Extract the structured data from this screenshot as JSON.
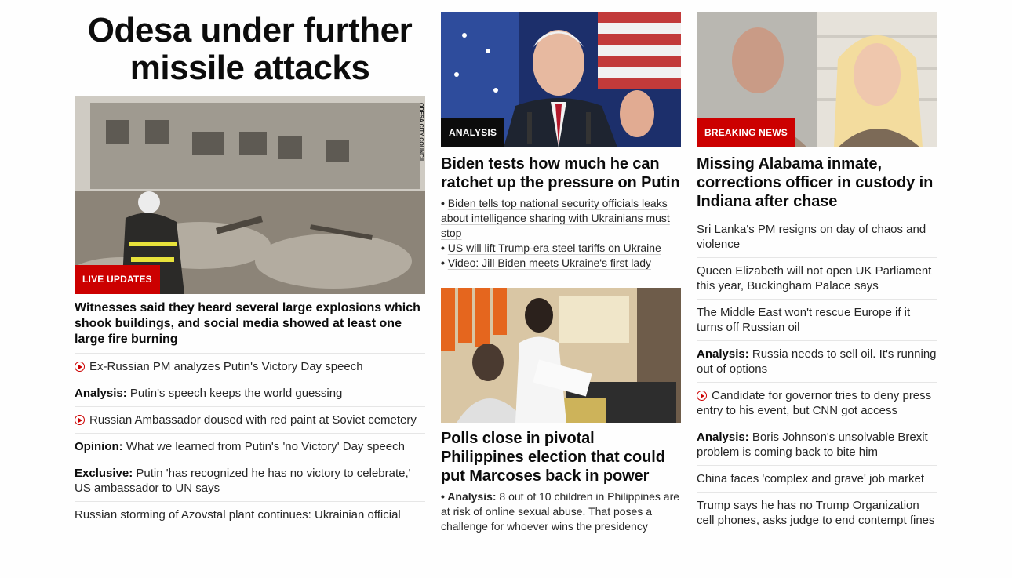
{
  "col1": {
    "title": "Odesa under further missile attacks",
    "photo_credit": "ODESA CITY COUNCIL",
    "tag": "LIVE UPDATES",
    "lead": "Witnesses said they heard several large explosions which shook buildings, and social media showed at least one large fire burning",
    "items": [
      {
        "prefix": "",
        "text": "Ex-Russian PM analyzes Putin's Victory Day speech",
        "video": true
      },
      {
        "prefix": "Analysis:",
        "text": "Putin's speech keeps the world guessing",
        "video": false
      },
      {
        "prefix": "",
        "text": "Russian Ambassador doused with red paint at Soviet cemetery",
        "video": true
      },
      {
        "prefix": "Opinion:",
        "text": "What we learned from Putin's 'no Victory' Day speech",
        "video": false
      },
      {
        "prefix": "Exclusive:",
        "text": "Putin 'has recognized he has no victory to celebrate,' US ambassador to UN says",
        "video": false
      },
      {
        "prefix": "",
        "text": "Russian storming of Azovstal plant continues: Ukrainian official",
        "video": false
      }
    ]
  },
  "col2": {
    "story1": {
      "tag": "ANALYSIS",
      "headline": "Biden tests how much he can ratchet up the pressure on Putin",
      "bullets": [
        "Biden tells top national security officials leaks about intelligence sharing with Ukrainians must stop",
        "US will lift Trump-era steel tariffs on Ukraine",
        "Video: Jill Biden meets Ukraine's first lady"
      ]
    },
    "story2": {
      "headline": "Polls close in pivotal Philippines election that could put Marcoses back in power",
      "bullet_prefix": "Analysis:",
      "bullet_text": "8 out of 10 children in Philippines are at risk of online sexual abuse. That poses a challenge for whoever wins the presidency"
    }
  },
  "col3": {
    "tag": "BREAKING NEWS",
    "headline": "Missing Alabama inmate, corrections officer in custody in Indiana after chase",
    "items": [
      {
        "prefix": "",
        "text": "Sri Lanka's PM resigns on day of chaos and violence",
        "video": false
      },
      {
        "prefix": "",
        "text": "Queen Elizabeth will not open UK Parliament this year, Buckingham Palace says",
        "video": false
      },
      {
        "prefix": "",
        "text": "The Middle East won't rescue Europe if it turns off Russian oil",
        "video": false
      },
      {
        "prefix": "Analysis:",
        "text": "Russia needs to sell oil. It's running out of options",
        "video": false
      },
      {
        "prefix": "",
        "text": "Candidate for governor tries to deny press entry to his event, but CNN got access",
        "video": true
      },
      {
        "prefix": "Analysis:",
        "text": "Boris Johnson's unsolvable Brexit problem is coming back to bite him",
        "video": false
      },
      {
        "prefix": "",
        "text": "China faces 'complex and grave' job market",
        "video": false
      },
      {
        "prefix": "",
        "text": "Trump says he has no Trump Organization cell phones, asks judge to end contempt fines",
        "video": false
      }
    ]
  },
  "colors": {
    "brand_red": "#cc0000",
    "text": "#0c0c0c",
    "divider": "#e6e6e6"
  }
}
